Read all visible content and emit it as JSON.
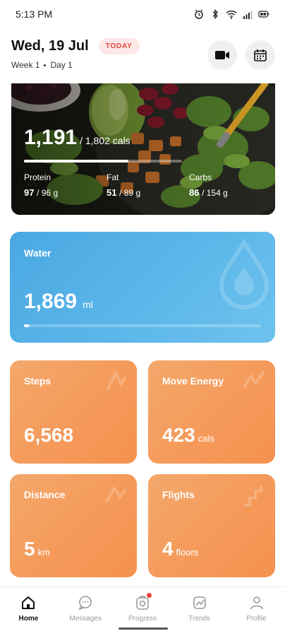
{
  "status_bar": {
    "time": "5:13 PM",
    "icons": [
      "alarm-icon",
      "bluetooth-icon",
      "wifi-icon",
      "signal-icon",
      "battery-icon"
    ]
  },
  "header": {
    "date": "Wed, 19 Jul",
    "today_badge": "TODAY",
    "week": "Week 1",
    "day": "Day 1",
    "buttons": [
      "video-icon",
      "calendar-icon"
    ]
  },
  "nutrition": {
    "calories": "1,191",
    "calories_goal": "/ 1,802 cals",
    "calories_fraction": 0.66,
    "macros": [
      {
        "label": "Protein",
        "value": "97",
        "goal": "/ 96 g"
      },
      {
        "label": "Fat",
        "value": "51",
        "goal": "/ 89 g"
      },
      {
        "label": "Carbs",
        "value": "86",
        "goal": "/ 154 g"
      }
    ]
  },
  "water": {
    "label": "Water",
    "value": "1,869",
    "unit": "ml",
    "progress_fraction": 0.02
  },
  "stats": {
    "steps": {
      "label": "Steps",
      "value": "6,568",
      "unit": ""
    },
    "move_energy": {
      "label": "Move Energy",
      "value": "423",
      "unit": "cals"
    },
    "distance": {
      "label": "Distance",
      "value": "5",
      "unit": "km"
    },
    "flights": {
      "label": "Flights",
      "value": "4",
      "unit": "floors"
    }
  },
  "colors": {
    "accent_red": "#e8423a",
    "water_blue": "#4aa8e2",
    "activity_orange": "#f59a5a"
  },
  "nav": {
    "items": [
      {
        "label": "Home",
        "icon": "home-icon",
        "active": true
      },
      {
        "label": "Messages",
        "icon": "messages-icon",
        "active": false
      },
      {
        "label": "Progress",
        "icon": "progress-icon",
        "active": false,
        "badge": true
      },
      {
        "label": "Trends",
        "icon": "trends-icon",
        "active": false
      },
      {
        "label": "Profile",
        "icon": "profile-icon",
        "active": false
      }
    ]
  }
}
